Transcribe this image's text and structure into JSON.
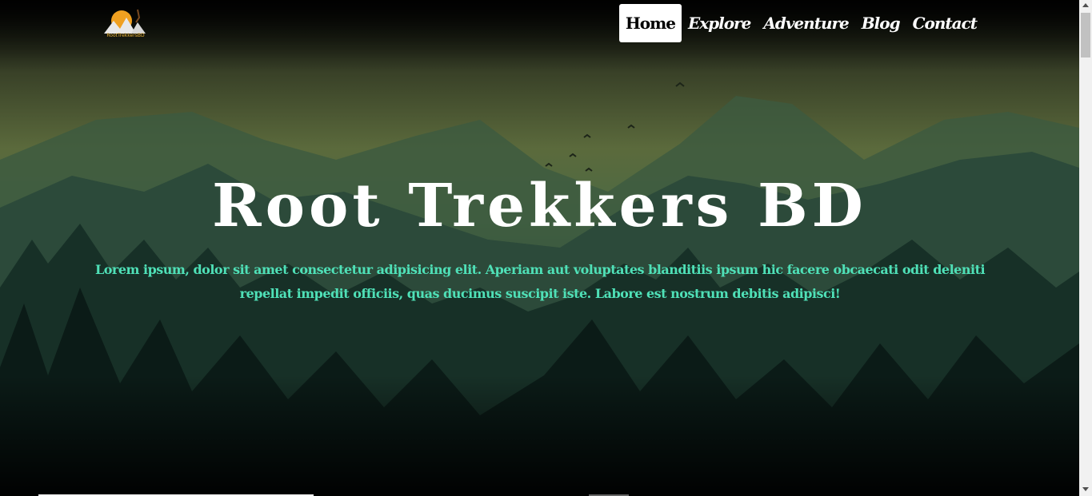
{
  "logo": {
    "text": "RootTrekkersBD"
  },
  "nav": {
    "items": [
      {
        "label": "Home",
        "active": true
      },
      {
        "label": "Explore",
        "active": false
      },
      {
        "label": "Adventure",
        "active": false
      },
      {
        "label": "Blog",
        "active": false
      },
      {
        "label": "Contact",
        "active": false
      }
    ]
  },
  "hero": {
    "title": "Root Trekkers BD",
    "subtitle": "Lorem ipsum, dolor sit amet consectetur adipisicing elit. Aperiam aut voluptates blanditiis ipsum hic facere obcaecati odit deleniti repellat impedit officiis, quas ducimus suscipit iste. Labore est nostrum debitis adipisci!"
  },
  "colors": {
    "subtitle": "#4fe0b7",
    "nav_active_bg": "#ffffff",
    "logo_sun": "#f0a020"
  }
}
